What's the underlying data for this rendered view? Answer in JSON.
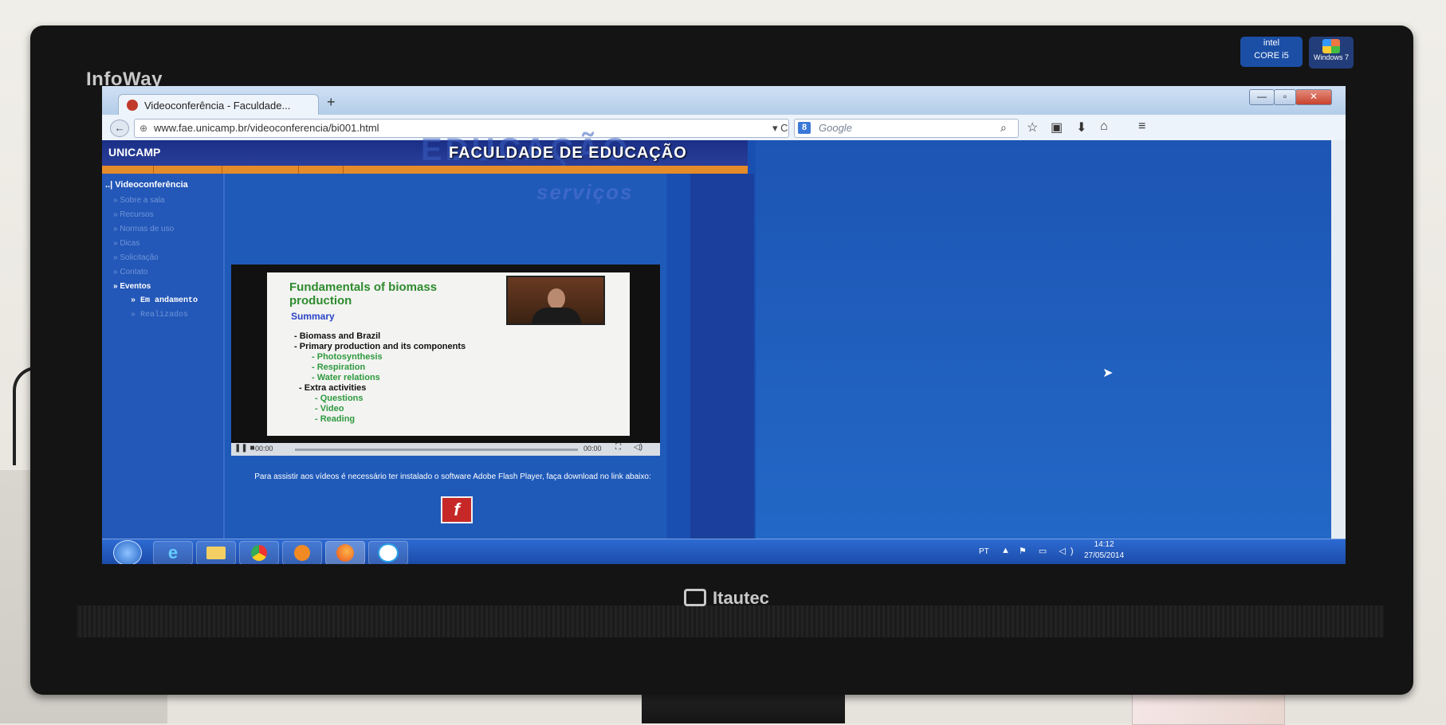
{
  "monitor": {
    "bezel_brand": "InfoWay",
    "maker_logo": "Itautec",
    "stickers": [
      "Intel Core i5",
      "Windows 7"
    ]
  },
  "browser": {
    "tab_title": "Videoconferência - Faculdade...",
    "tab_icon": "unicamp-favicon",
    "new_tab": "+",
    "url": "www.fae.unicamp.br/videoconferencia/bi001.html",
    "search_placeholder": "Google",
    "window_buttons": [
      "minimize",
      "maximize",
      "close"
    ],
    "toolbar_icons": [
      "search-icon",
      "star-icon",
      "clipboard-icon",
      "download-icon",
      "home-icon",
      "menu-icon"
    ]
  },
  "site": {
    "unicamp": "UNICAMP",
    "title": "FACULDADE DE EDUCAÇÃO",
    "services": "serviços",
    "nav_heading": "Videoconferência",
    "nav_items": [
      {
        "label": "Sobre a sala",
        "state": "dim"
      },
      {
        "label": "Recursos",
        "state": "dim"
      },
      {
        "label": "Normas de uso",
        "state": "dim"
      },
      {
        "label": "Dicas",
        "state": "dim"
      },
      {
        "label": "Solicitação",
        "state": "dim"
      },
      {
        "label": "Contato",
        "state": "dim"
      },
      {
        "label": "Eventos",
        "state": "active"
      }
    ],
    "sub_items": [
      {
        "label": "Em andamento",
        "state": "active"
      },
      {
        "label": "Realizados",
        "state": "dim"
      }
    ]
  },
  "video": {
    "slide": {
      "title": "Fundamentals of biomass production",
      "summary": "Summary",
      "items": [
        {
          "text": "Biomass and Brazil",
          "level": 0
        },
        {
          "text": "Primary production and its components",
          "level": 0
        },
        {
          "text": "Photosynthesis",
          "level": 1
        },
        {
          "text": "Respiration",
          "level": 1
        },
        {
          "text": "Water relations",
          "level": 1
        },
        {
          "text": "Extra activities",
          "level": 0
        },
        {
          "text": "Questions",
          "level": 1
        },
        {
          "text": "Video",
          "level": 1
        },
        {
          "text": "Reading",
          "level": 1
        }
      ]
    },
    "current_time": "00:00",
    "duration": "00:00"
  },
  "flash_notice": "Para assistir aos vídeos é necessário ter instalado o software Adobe Flash Player, faça download no link abaixo:",
  "flash_button_icon": "f",
  "taskbar": {
    "apps": [
      "ie-icon",
      "explorer-icon",
      "chrome-icon",
      "media-player-icon",
      "firefox-icon",
      "skype-icon"
    ],
    "language": "PT",
    "time": "14:12",
    "date": "27/05/2014"
  }
}
